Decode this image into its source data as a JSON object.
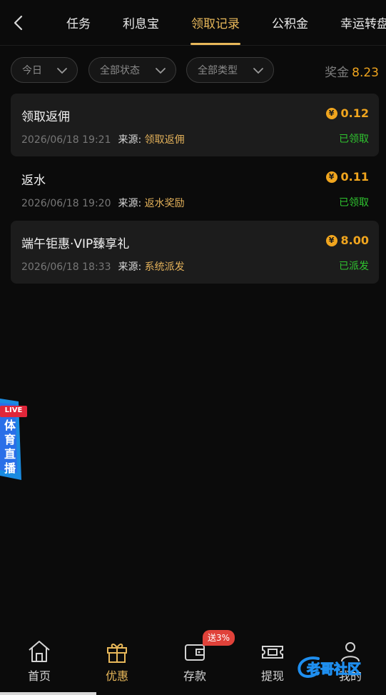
{
  "header": {
    "back_icon": "chevron-left-icon",
    "tabs": [
      {
        "label": "任务",
        "active": false
      },
      {
        "label": "利息宝",
        "active": false
      },
      {
        "label": "领取记录",
        "active": true
      },
      {
        "label": "公积金",
        "active": false
      },
      {
        "label": "幸运转盘",
        "active": false
      }
    ]
  },
  "filters": {
    "date": "今日",
    "status": "全部状态",
    "type": "全部类型",
    "bonus_label": "奖金",
    "bonus_value": "8.23"
  },
  "records": [
    {
      "title": "领取返佣",
      "amount": "0.12",
      "time": "2026/06/18 19:21",
      "source_label": "来源:",
      "source": "领取返佣",
      "status": "已领取"
    },
    {
      "title": "返水",
      "amount": "0.11",
      "time": "2026/06/18 19:20",
      "source_label": "来源:",
      "source": "返水奖励",
      "status": "已领取"
    },
    {
      "title": "端午钜惠·VIP臻享礼",
      "amount": "8.00",
      "time": "2026/06/18 18:33",
      "source_label": "来源:",
      "source": "系统派发",
      "status": "已派发"
    }
  ],
  "coin_symbol": "¥",
  "live_badge": {
    "tag": "LIVE",
    "text": "体育直播"
  },
  "bottom_nav": {
    "items": [
      {
        "label": "首页",
        "icon": "home-icon"
      },
      {
        "label": "优惠",
        "icon": "gift-icon",
        "active": true
      },
      {
        "label": "存款",
        "icon": "wallet-icon"
      },
      {
        "label": "提现",
        "icon": "withdraw-icon"
      },
      {
        "label": "我的",
        "icon": "user-icon"
      }
    ],
    "deposit_badge": "送3%"
  },
  "watermark": "老哥社区",
  "colors": {
    "accent": "#e8b85a",
    "amount": "#f0a51e",
    "success": "#2fc52f",
    "badge": "#e0423a"
  }
}
